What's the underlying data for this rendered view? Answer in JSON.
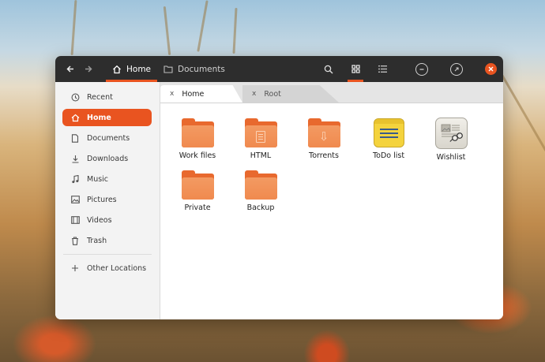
{
  "header": {
    "back_icon": "arrow-left-icon",
    "forward_icon": "arrow-right-icon",
    "breadcrumbs": [
      {
        "label": "Home",
        "icon": "home-icon",
        "active": true
      },
      {
        "label": "Documents",
        "icon": "folder-icon",
        "active": false
      }
    ]
  },
  "sidebar": {
    "items": [
      {
        "label": "Recent",
        "icon": "clock-icon",
        "active": false
      },
      {
        "label": "Home",
        "icon": "home-icon",
        "active": true
      },
      {
        "label": "Documents",
        "icon": "document-icon",
        "active": false
      },
      {
        "label": "Downloads",
        "icon": "download-icon",
        "active": false
      },
      {
        "label": "Music",
        "icon": "music-icon",
        "active": false
      },
      {
        "label": "Pictures",
        "icon": "picture-icon",
        "active": false
      },
      {
        "label": "Videos",
        "icon": "film-icon",
        "active": false
      },
      {
        "label": "Trash",
        "icon": "trash-icon",
        "active": false
      }
    ],
    "other": {
      "label": "Other Locations",
      "icon": "plus-icon"
    }
  },
  "tabs": [
    {
      "label": "Home",
      "close": "x",
      "active": true
    },
    {
      "label": "Root",
      "close": "x",
      "active": false
    }
  ],
  "files": [
    {
      "label": "Work files",
      "type": "folder"
    },
    {
      "label": "HTML",
      "type": "folder-document"
    },
    {
      "label": "Torrents",
      "type": "folder-download"
    },
    {
      "label": "ToDo list",
      "type": "note"
    },
    {
      "label": "Wishlist",
      "type": "document-image"
    },
    {
      "label": "Private",
      "type": "folder"
    },
    {
      "label": "Backup",
      "type": "folder"
    }
  ],
  "colors": {
    "accent": "#e95420",
    "folder": "#f08a4f",
    "headerbar": "#2d2d2d"
  }
}
